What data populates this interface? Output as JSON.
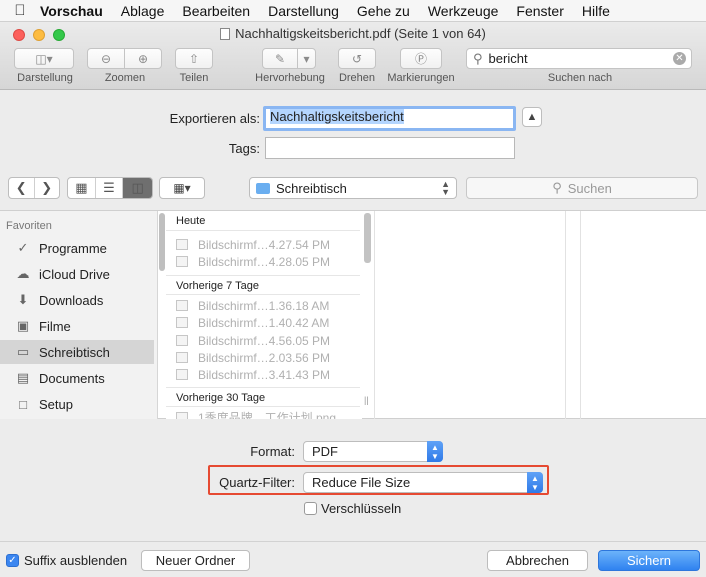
{
  "menubar": {
    "app": "Vorschau",
    "items": [
      "Ablage",
      "Bearbeiten",
      "Darstellung",
      "Gehe zu",
      "Werkzeuge",
      "Fenster",
      "Hilfe"
    ]
  },
  "window": {
    "title": "Nachhaltigskeitsbericht.pdf (Seite 1 von 64)"
  },
  "toolbar": {
    "darstellung": "Darstellung",
    "zoomen": "Zoomen",
    "teilen": "Teilen",
    "hervorhebung": "Hervorhebung",
    "drehen": "Drehen",
    "markierungen": "Markierungen",
    "suchen_nach": "Suchen nach",
    "search_value": "bericht"
  },
  "export": {
    "label": "Exportieren als:",
    "filename": "Nachhaltigskeitsbericht",
    "tags_label": "Tags:",
    "tags_value": ""
  },
  "nav": {
    "location": "Schreibtisch",
    "search_placeholder": "Suchen"
  },
  "sidebar": {
    "heading": "Favoriten",
    "items": [
      {
        "label": "Programme",
        "icon": "apps-icon"
      },
      {
        "label": "iCloud Drive",
        "icon": "cloud-icon"
      },
      {
        "label": "Downloads",
        "icon": "download-icon"
      },
      {
        "label": "Filme",
        "icon": "film-icon"
      },
      {
        "label": "Schreibtisch",
        "icon": "desktop-icon"
      },
      {
        "label": "Documents",
        "icon": "document-icon"
      },
      {
        "label": "Setup",
        "icon": "folder-icon"
      }
    ]
  },
  "files": {
    "group_today": "Heute",
    "today": [
      "Bildschirmf…4.27.54 PM",
      "Bildschirmf…4.28.05 PM"
    ],
    "group_week": "Vorherige 7 Tage",
    "week": [
      "Bildschirmf…1.36.18 AM",
      "Bildschirmf…1.40.42 AM",
      "Bildschirmf…4.56.05 PM",
      "Bildschirmf…2.03.56 PM",
      "Bildschirmf…3.41.43 PM"
    ],
    "group_month": "Vorherige 30 Tage",
    "month": [
      "1季度品牌…工作计划.png"
    ]
  },
  "options": {
    "format_label": "Format:",
    "format_value": "PDF",
    "quartz_label": "Quartz-Filter:",
    "quartz_value": "Reduce File Size",
    "encrypt_label": "Verschlüsseln"
  },
  "bottom": {
    "suffix_label": "Suffix ausblenden",
    "new_folder": "Neuer Ordner",
    "cancel": "Abbrechen",
    "save": "Sichern"
  },
  "colors": {
    "accent": "#3b86f0",
    "highlight": "#e64a32"
  }
}
